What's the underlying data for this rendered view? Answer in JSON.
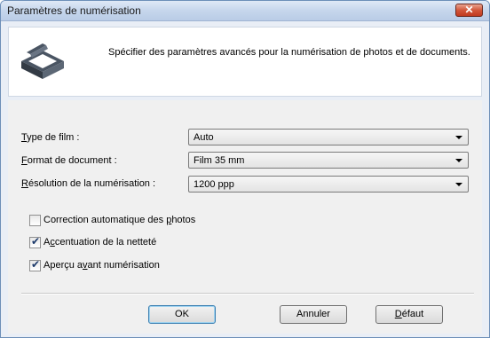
{
  "window": {
    "title": "Paramètres de numérisation",
    "header_text": "Spécifier des paramètres avancés pour la numérisation de photos et de documents."
  },
  "fields": [
    {
      "label_pre": "",
      "label_key": "T",
      "label_post": "ype de film :",
      "value": "Auto"
    },
    {
      "label_pre": "",
      "label_key": "F",
      "label_post": "ormat de document :",
      "value": "Film 35 mm"
    },
    {
      "label_pre": "",
      "label_key": "R",
      "label_post": "ésolution de la numérisation :",
      "value": "1200 ppp"
    }
  ],
  "checks": [
    {
      "label_pre": "Correction automatique des ",
      "label_key": "p",
      "label_post": "hotos",
      "checked": false
    },
    {
      "label_pre": "A",
      "label_key": "c",
      "label_post": "centuation de la netteté",
      "checked": true
    },
    {
      "label_pre": "Aperçu a",
      "label_key": "v",
      "label_post": "ant numérisation",
      "checked": true
    }
  ],
  "buttons": {
    "ok": "OK",
    "cancel": "Annuler",
    "default_pre": "",
    "default_key": "D",
    "default_post": "éfaut"
  },
  "colors": {
    "title_gradient_top": "#dfe9f6",
    "close_red": "#c03a1f",
    "icon_dark": "#4a5563"
  },
  "icons": {
    "close": "close-icon",
    "scanner": "scanner-icon"
  }
}
